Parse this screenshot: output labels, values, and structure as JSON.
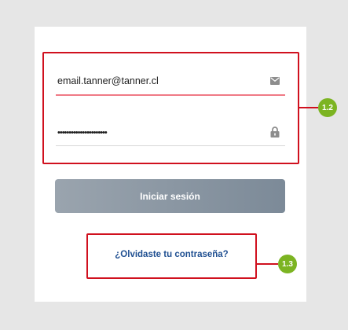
{
  "login": {
    "email_value": "email.tanner@tanner.cl",
    "password_value": "••••••••••••••••••••••",
    "submit_label": "Iniciar sesión",
    "forgot_label": "¿Olvidaste tu contraseña?"
  },
  "annotations": {
    "badge_fields": "1.2",
    "badge_forgot": "1.3"
  },
  "icons": {
    "email": "envelope-icon",
    "password": "lock-icon"
  },
  "colors": {
    "highlight": "#d0101e",
    "badge": "#7cb422",
    "email_underline": "#ef7a85",
    "link": "#1f4f91",
    "button": "#8a96a2"
  }
}
